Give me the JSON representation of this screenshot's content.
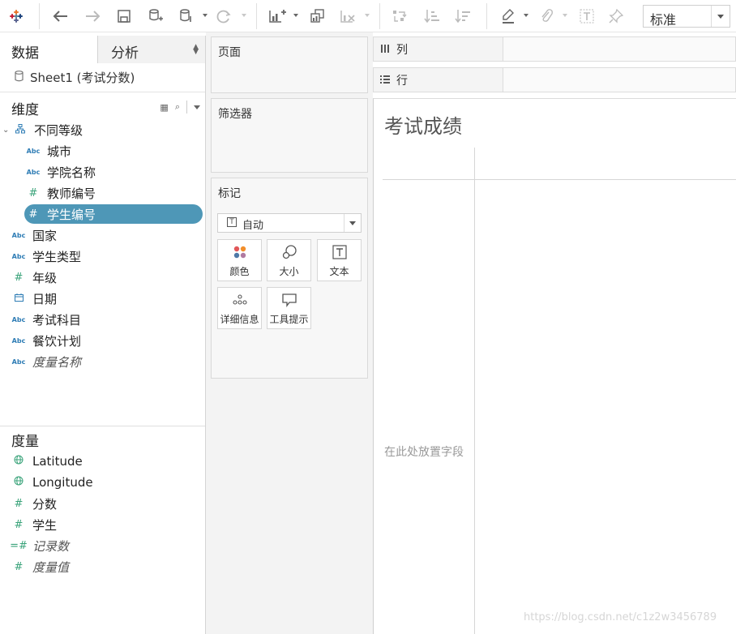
{
  "toolbar": {
    "view_select": "标准",
    "icons": [
      "tableau-logo-icon",
      "undo-icon",
      "redo-icon",
      "save-icon",
      "new-datasource-icon",
      "pause-updates-icon",
      "refresh-icon",
      "new-worksheet-icon",
      "duplicate-icon",
      "clear-icon",
      "swap-icon",
      "sort-ascending-icon",
      "sort-descending-icon",
      "highlight-icon",
      "annotate-icon",
      "label-icon",
      "pin-icon"
    ]
  },
  "data_pane": {
    "tabs": [
      "数据",
      "分析"
    ],
    "datasource": "Sheet1 (考试分数)",
    "dimensions_title": "维度",
    "hierarchy": "不同等级",
    "hierarchy_children": [
      {
        "icon": "Abc",
        "label": "城市"
      },
      {
        "icon": "Abc",
        "label": "学院名称"
      },
      {
        "icon": "#",
        "label": "教师编号"
      },
      {
        "icon": "#",
        "label": "学生编号"
      }
    ],
    "dimensions": [
      {
        "icon": "Abc",
        "label": "国家"
      },
      {
        "icon": "Abc",
        "label": "学生类型"
      },
      {
        "icon": "#",
        "label": "年级"
      },
      {
        "icon": "date",
        "label": "日期"
      },
      {
        "icon": "Abc",
        "label": "考试科目"
      },
      {
        "icon": "Abc",
        "label": "餐饮计划"
      },
      {
        "icon": "Abc",
        "label": "度量名称"
      }
    ],
    "measures_title": "度量",
    "measures": [
      {
        "icon": "globe",
        "label": "Latitude"
      },
      {
        "icon": "globe",
        "label": "Longitude"
      },
      {
        "icon": "#",
        "label": "分数"
      },
      {
        "icon": "#",
        "label": "学生"
      },
      {
        "icon": "=#",
        "label": "记录数"
      },
      {
        "icon": "#",
        "label": "度量值"
      }
    ]
  },
  "cards": {
    "pages": "页面",
    "filters": "筛选器",
    "marks": "标记",
    "mark_type": "自动",
    "mark_type_icon": "T",
    "mark_buttons": [
      "颜色",
      "大小",
      "文本",
      "详细信息",
      "工具提示"
    ]
  },
  "shelves": {
    "columns": "列",
    "rows": "行"
  },
  "view": {
    "title": "考试成绩",
    "drop_hint": "在此处放置字段"
  },
  "watermark": "https://blog.csdn.net/c1z2w3456789"
}
